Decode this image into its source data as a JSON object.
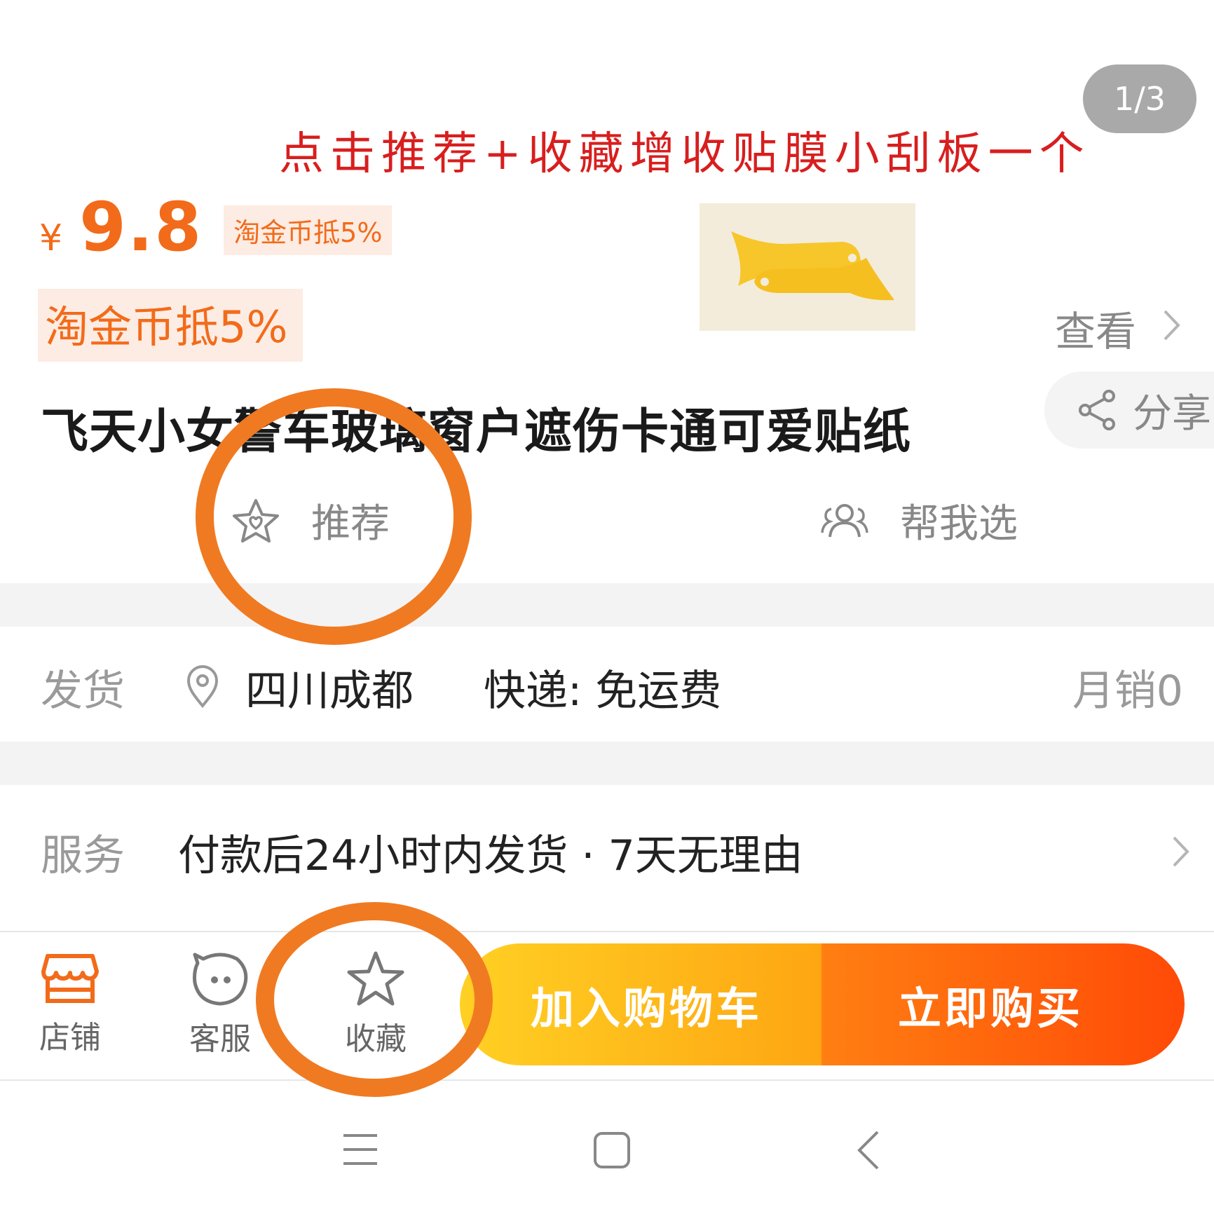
{
  "gallery": {
    "counter": "1/3"
  },
  "promo_banner": "点击推荐+收藏增收贴膜小刮板一个",
  "price": {
    "currency": "¥",
    "value": "9.8",
    "coin_discount": "淘金币抵5%"
  },
  "coin_badge": "淘金币抵5%",
  "view_link": "查看",
  "share": "分享",
  "product": {
    "title": "飞天小女警车玻璃窗户遮伤卡通可爱贴纸"
  },
  "actions": {
    "recommend": "推荐",
    "help_me_choose": "帮我选"
  },
  "shipping": {
    "label": "发货",
    "location": "四川成都",
    "express": "快递: 免运费",
    "monthly_sales": "月销0"
  },
  "service": {
    "label": "服务",
    "text": "付款后24小时内发货 · 7天无理由"
  },
  "bottom_nav": {
    "store": "店铺",
    "customer_service": "客服",
    "favorite": "收藏"
  },
  "buttons": {
    "add_to_cart": "加入购物车",
    "buy_now": "立即购买"
  },
  "colors": {
    "accent_orange": "#f26b1a",
    "annotation_circle": "#f07a22",
    "promo_red": "#d81e1e",
    "cart_yellow": "#ffc21a",
    "buy_orange": "#ff5a0a"
  }
}
